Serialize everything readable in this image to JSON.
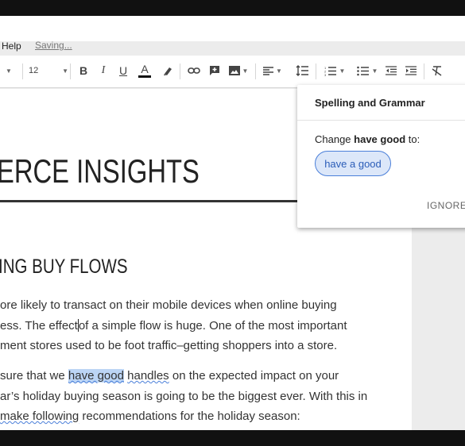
{
  "menu": {
    "help": "Help",
    "saving": "Saving..."
  },
  "toolbar": {
    "style_caret": "s",
    "font_size": "12",
    "bold": "B",
    "italic": "I",
    "underline": "U",
    "text_color": "A"
  },
  "document": {
    "heading1": "ERCE INSIGHTS",
    "heading2": "ING BUY FLOWS",
    "paragraph1": [
      "ore likely to transact on their mobile devices when online buying",
      "ess. The effect",
      "of a simple flow is huge. One of the most important",
      "ment stores used to be foot traffic–getting shoppers into a store."
    ],
    "paragraph2": {
      "line1_pre": " sure that we ",
      "line1_highlight": "have good",
      "line1_space": " ",
      "line1_squiggle": "handles",
      "line1_post": " on the expected impact on your",
      "line2": "ar’s holiday buying season is going to be the biggest ever. With this in",
      "line3_squiggle": "make following",
      "line3_post": " recommendations for the holiday season:"
    }
  },
  "spelling_panel": {
    "title": "Spelling and Grammar",
    "change_prefix": "Change ",
    "change_word": "have good",
    "change_suffix": " to:",
    "suggestion": "have a good",
    "ignore": "IGNORE"
  }
}
